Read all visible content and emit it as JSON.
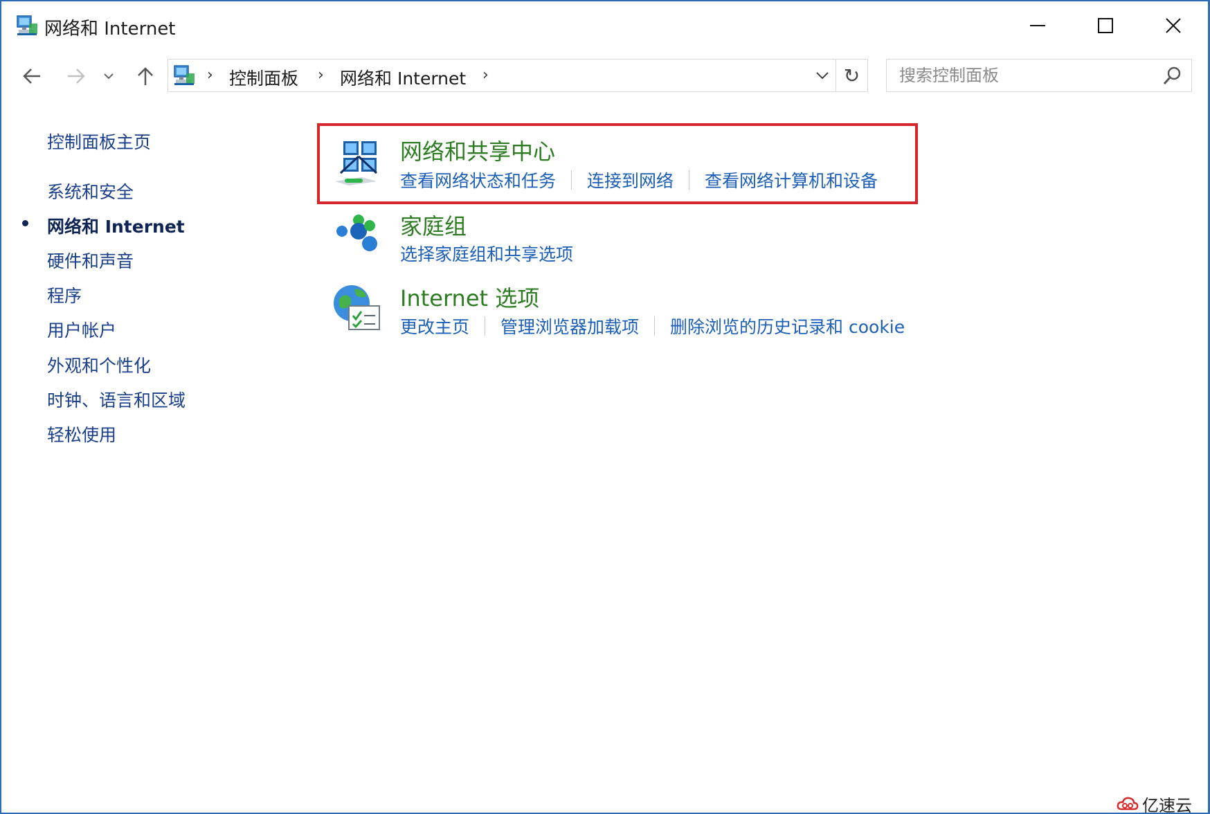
{
  "window": {
    "title": "网络和 Internet",
    "controls": {
      "minimize": "minimize",
      "maximize": "maximize",
      "close": "close"
    }
  },
  "nav": {
    "breadcrumbs": [
      "控制面板",
      "网络和 Internet"
    ],
    "search_placeholder": "搜索控制面板"
  },
  "sidebar": {
    "items": [
      {
        "label": "控制面板主页",
        "active": false
      },
      {
        "label": "系统和安全",
        "active": false
      },
      {
        "label": "网络和 Internet",
        "active": true
      },
      {
        "label": "硬件和声音",
        "active": false
      },
      {
        "label": "程序",
        "active": false
      },
      {
        "label": "用户帐户",
        "active": false
      },
      {
        "label": "外观和个性化",
        "active": false
      },
      {
        "label": "时钟、语言和区域",
        "active": false
      },
      {
        "label": "轻松使用",
        "active": false
      }
    ]
  },
  "categories": [
    {
      "title": "网络和共享中心",
      "icon": "network-sharing-center-icon",
      "highlighted": true,
      "links": [
        "查看网络状态和任务",
        "连接到网络",
        "查看网络计算机和设备"
      ]
    },
    {
      "title": "家庭组",
      "icon": "homegroup-icon",
      "highlighted": false,
      "links": [
        "选择家庭组和共享选项"
      ]
    },
    {
      "title": "Internet 选项",
      "icon": "internet-options-icon",
      "highlighted": false,
      "links": [
        "更改主页",
        "管理浏览器加载项",
        "删除浏览的历史记录和 cookie"
      ]
    }
  ],
  "watermark": {
    "text": "亿速云"
  },
  "colors": {
    "highlight_border": "#d5262d",
    "category_title": "#2d7c22",
    "link": "#1c5fb7",
    "sidebar_link": "#1a3f8a",
    "window_border": "#2b6cb5"
  }
}
